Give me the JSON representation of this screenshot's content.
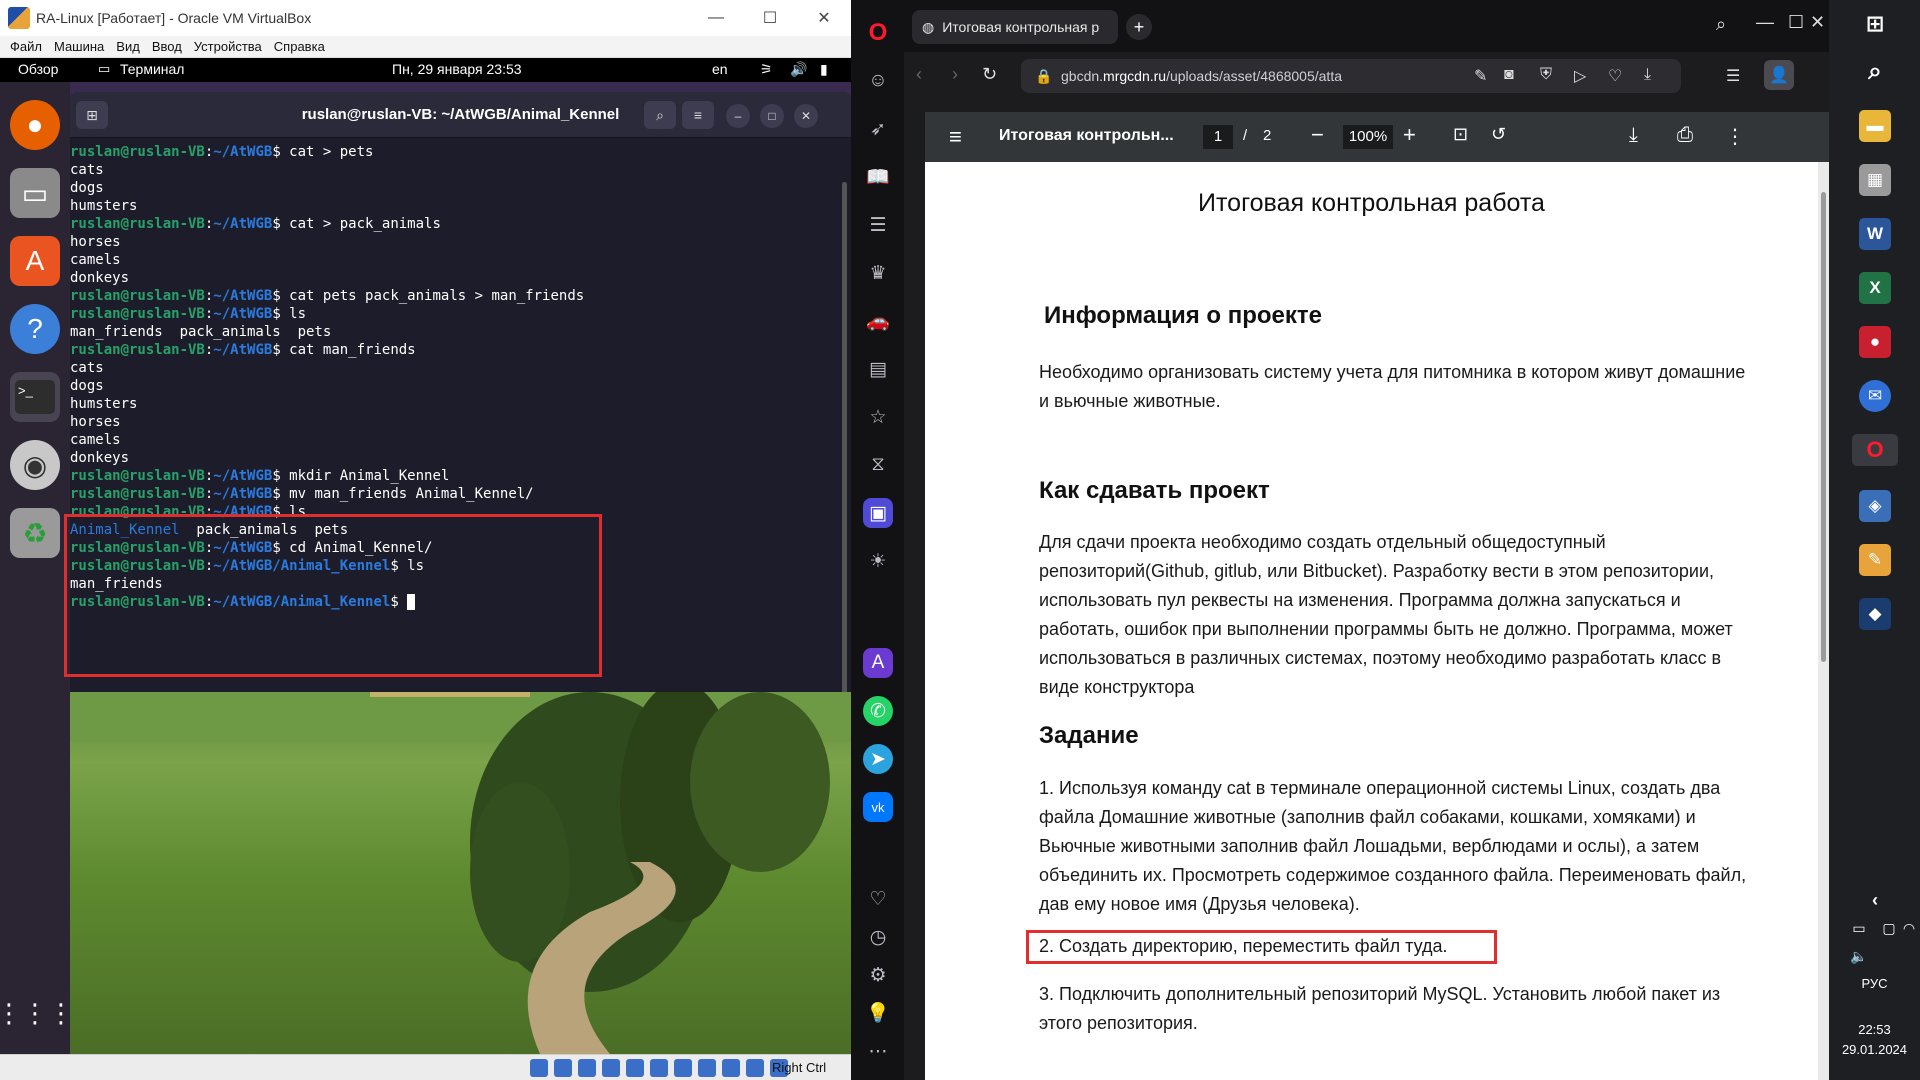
{
  "vbox": {
    "title": "RA-Linux [Работает] - Oracle VM VirtualBox",
    "menu": [
      "Файл",
      "Машина",
      "Вид",
      "Ввод",
      "Устройства",
      "Справка"
    ],
    "host_key": "Right Ctrl"
  },
  "gnome": {
    "activities": "Обзор",
    "app_name": "Терминал",
    "clock": "Пн, 29 января  23:53",
    "lang": "en"
  },
  "terminal": {
    "title": "ruslan@ruslan-VB: ~/AtWGB/Animal_Kennel",
    "lines": [
      {
        "user": "ruslan@ruslan-VB",
        "path": "~/AtWGB",
        "cmd": " cat > pets"
      },
      {
        "text": "cats"
      },
      {
        "text": "dogs"
      },
      {
        "text": "humsters"
      },
      {
        "user": "ruslan@ruslan-VB",
        "path": "~/AtWGB",
        "cmd": " cat > pack_animals"
      },
      {
        "text": "horses"
      },
      {
        "text": "camels"
      },
      {
        "text": "donkeys"
      },
      {
        "user": "ruslan@ruslan-VB",
        "path": "~/AtWGB",
        "cmd": " cat pets pack_animals > man_friends"
      },
      {
        "user": "ruslan@ruslan-VB",
        "path": "~/AtWGB",
        "cmd": " ls"
      },
      {
        "text": "man_friends  pack_animals  pets"
      },
      {
        "user": "ruslan@ruslan-VB",
        "path": "~/AtWGB",
        "cmd": " cat man_friends"
      },
      {
        "text": "cats"
      },
      {
        "text": "dogs"
      },
      {
        "text": "humsters"
      },
      {
        "text": "horses"
      },
      {
        "text": "camels"
      },
      {
        "text": "donkeys"
      },
      {
        "user": "ruslan@ruslan-VB",
        "path": "~/AtWGB",
        "cmd": " mkdir Animal_Kennel"
      },
      {
        "user": "ruslan@ruslan-VB",
        "path": "~/AtWGB",
        "cmd": " mv man_friends Animal_Kennel/"
      },
      {
        "user": "ruslan@ruslan-VB",
        "path": "~/AtWGB",
        "cmd": " ls"
      },
      {
        "dir": "Animal_Kennel",
        "text": "  pack_animals  pets"
      },
      {
        "user": "ruslan@ruslan-VB",
        "path": "~/AtWGB",
        "cmd": " cd Animal_Kennel/"
      },
      {
        "user": "ruslan@ruslan-VB",
        "path": "~/AtWGB/Animal_Kennel",
        "cmd": " ls"
      },
      {
        "text": "man_friends"
      },
      {
        "user": "ruslan@ruslan-VB",
        "path": "~/AtWGB/Animal_Kennel",
        "cmd": " ",
        "cursor": true
      }
    ]
  },
  "browser": {
    "tab_title": "Итоговая контрольная р",
    "url_prefix": "gbcdn.",
    "url_domain": "mrgcdn.ru",
    "url_rest": "/uploads/asset/4868005/atta",
    "pdf_title": "Итоговая контрольн...",
    "page_current": "1",
    "page_sep": "/",
    "page_total": "2",
    "zoom": "100%"
  },
  "pdf": {
    "h1": "Итоговая контрольная работа",
    "h2_info": "Информация о проекте",
    "p_info": "Необходимо организовать систему учета для питомника в котором живут домашние и вьючные животные.",
    "h2_submit": "Как сдавать проект",
    "p_submit": "Для сдачи проекта необходимо создать отдельный общедоступный репозиторий(Github, gitlub, или Bitbucket). Разработку вести в этом репозитории, использовать пул реквесты на изменения. Программа должна запускаться и работать, ошибок при выполнении программы быть не должно. Программа, может использоваться в различных системах, поэтому необходимо разработать класс в виде конструктора",
    "h2_task": "Задание",
    "task1": "1. Используя команду cat в терминале операционной системы Linux, создать два файла Домашние животные (заполнив файл собаками, кошками, хомяками) и Вьючные животными заполнив файл Лошадьми, верблюдами и ослы), а затем объединить их. Просмотреть содержимое созданного файла. Переименовать файл, дав ему новое имя (Друзья человека).",
    "task2": "2. Создать директорию, переместить файл туда.",
    "task3": "3. Подключить дополнительный репозиторий MySQL. Установить любой пакет из этого репозитория."
  },
  "taskbar": {
    "lang": "РУС",
    "time": "22:53",
    "date": "29.01.2024"
  },
  "colors": {
    "highlight": "#e02d2d",
    "prompt_user": "#26a269",
    "prompt_path": "#2a7bde"
  }
}
